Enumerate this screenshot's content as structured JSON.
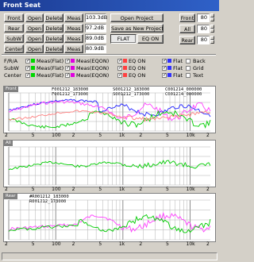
{
  "window": {
    "title": "Front Seat"
  },
  "rows": [
    {
      "name": "Front",
      "open": "Open",
      "delete": "Delete",
      "meas": "Meas",
      "value": "103.3dB"
    },
    {
      "name": "Rear",
      "open": "Open",
      "delete": "Delete",
      "meas": "Meas",
      "value": "97.2dB"
    },
    {
      "name": "SubW",
      "open": "Open",
      "delete": "Delete",
      "meas": "Meas",
      "value": "89.0dB"
    },
    {
      "name": "Center",
      "open": "Open",
      "delete": "Delete",
      "meas": "Meas",
      "value": "80.9dB"
    }
  ],
  "project": {
    "open": "Open Project",
    "save": "Save as New Project",
    "flat": "FLAT",
    "eq_on": "EQ ON"
  },
  "levels": [
    {
      "label": "Front",
      "value": "80"
    },
    {
      "label": "All",
      "value": "80"
    },
    {
      "label": "Rear",
      "value": "80"
    }
  ],
  "legend": {
    "row_labels": [
      "F/R/A",
      "SubW",
      "Center"
    ],
    "col_labels": [
      "Meas(Flat)",
      "Meas(EQON)",
      "EQ ON",
      "Flat"
    ],
    "extra": [
      "Back",
      "Grid",
      "Text"
    ]
  },
  "colors": {
    "meas_flat": "#00d800",
    "meas_eqon": "#e000e0",
    "eq_on": "#ff4040",
    "flat": "#3030ff",
    "green": "#00cc00",
    "pink": "#ff40ff",
    "blue": "#2020ff",
    "grid": "#b0b0b0"
  },
  "graphs": [
    {
      "tag": "Front",
      "files": [
        "F001212_183000",
        "F001212_173000"
      ],
      "files2": [
        "S001212_183000",
        "S001212_173000"
      ],
      "files3": [
        "C001214_000000",
        "C001214_000000"
      ]
    },
    {
      "tag": "All"
    },
    {
      "tag": "Rear",
      "files": [
        "#R001212_183000",
        "R001212_173000"
      ]
    }
  ],
  "axis_ticks": [
    "2",
    "5",
    "100",
    "2",
    "5",
    "1k",
    "2",
    "5",
    "10k",
    "2"
  ]
}
